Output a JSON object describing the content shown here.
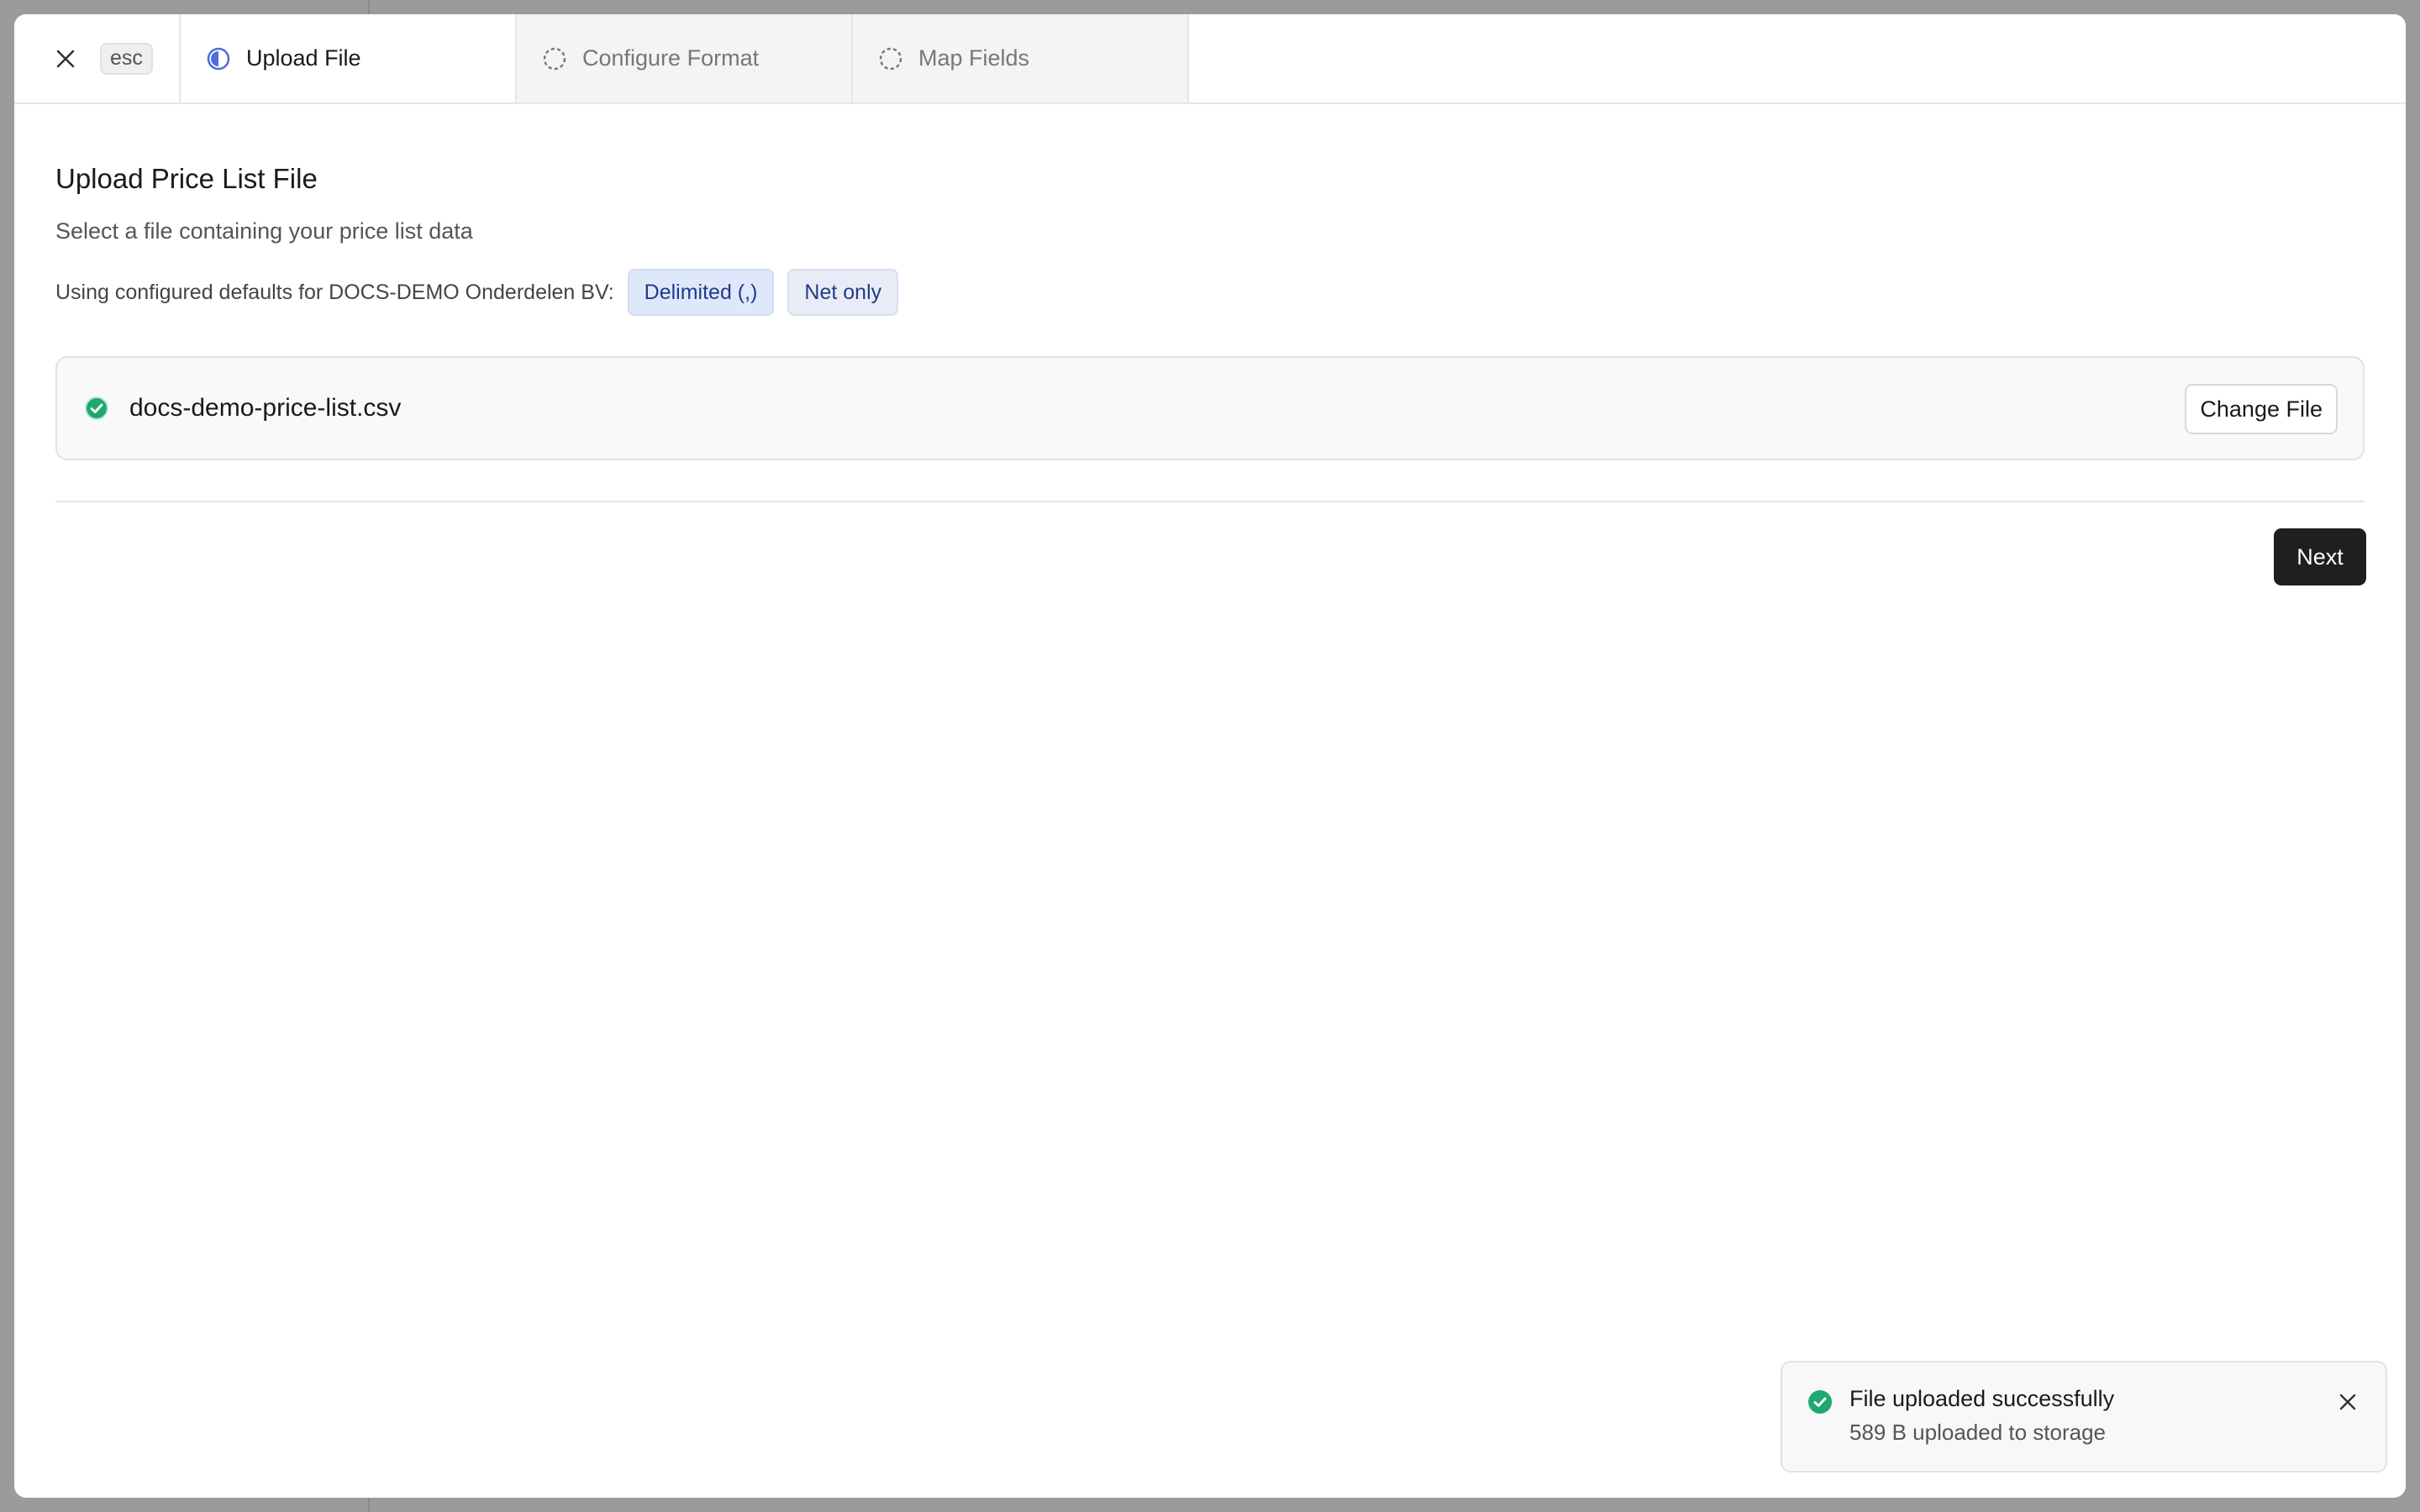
{
  "header": {
    "close_icon": "close-icon",
    "esc_label": "esc",
    "steps": [
      {
        "label": "Upload File",
        "state": "active",
        "icon": "half-circle-progress-icon"
      },
      {
        "label": "Configure Format",
        "state": "pending",
        "icon": "dashed-circle-icon"
      },
      {
        "label": "Map Fields",
        "state": "pending",
        "icon": "dashed-circle-icon"
      }
    ]
  },
  "main": {
    "title": "Upload Price List File",
    "subtitle": "Select a file containing your price list data",
    "defaults_text": "Using configured defaults for DOCS-DEMO Onderdelen BV:",
    "badges": [
      "Delimited (,)",
      "Net only"
    ],
    "file": {
      "name": "docs-demo-price-list.csv",
      "status_icon": "check-circle-icon",
      "change_label": "Change File"
    },
    "next_label": "Next"
  },
  "toast": {
    "title": "File uploaded successfully",
    "description": "589 B uploaded to storage",
    "icon": "check-circle-icon"
  },
  "colors": {
    "accent": "#4f6fd8",
    "success": "#1fa971",
    "primary_button": "#1f1f1f",
    "badge_bg": "#dfe8fb",
    "badge_text": "#223a8a"
  }
}
